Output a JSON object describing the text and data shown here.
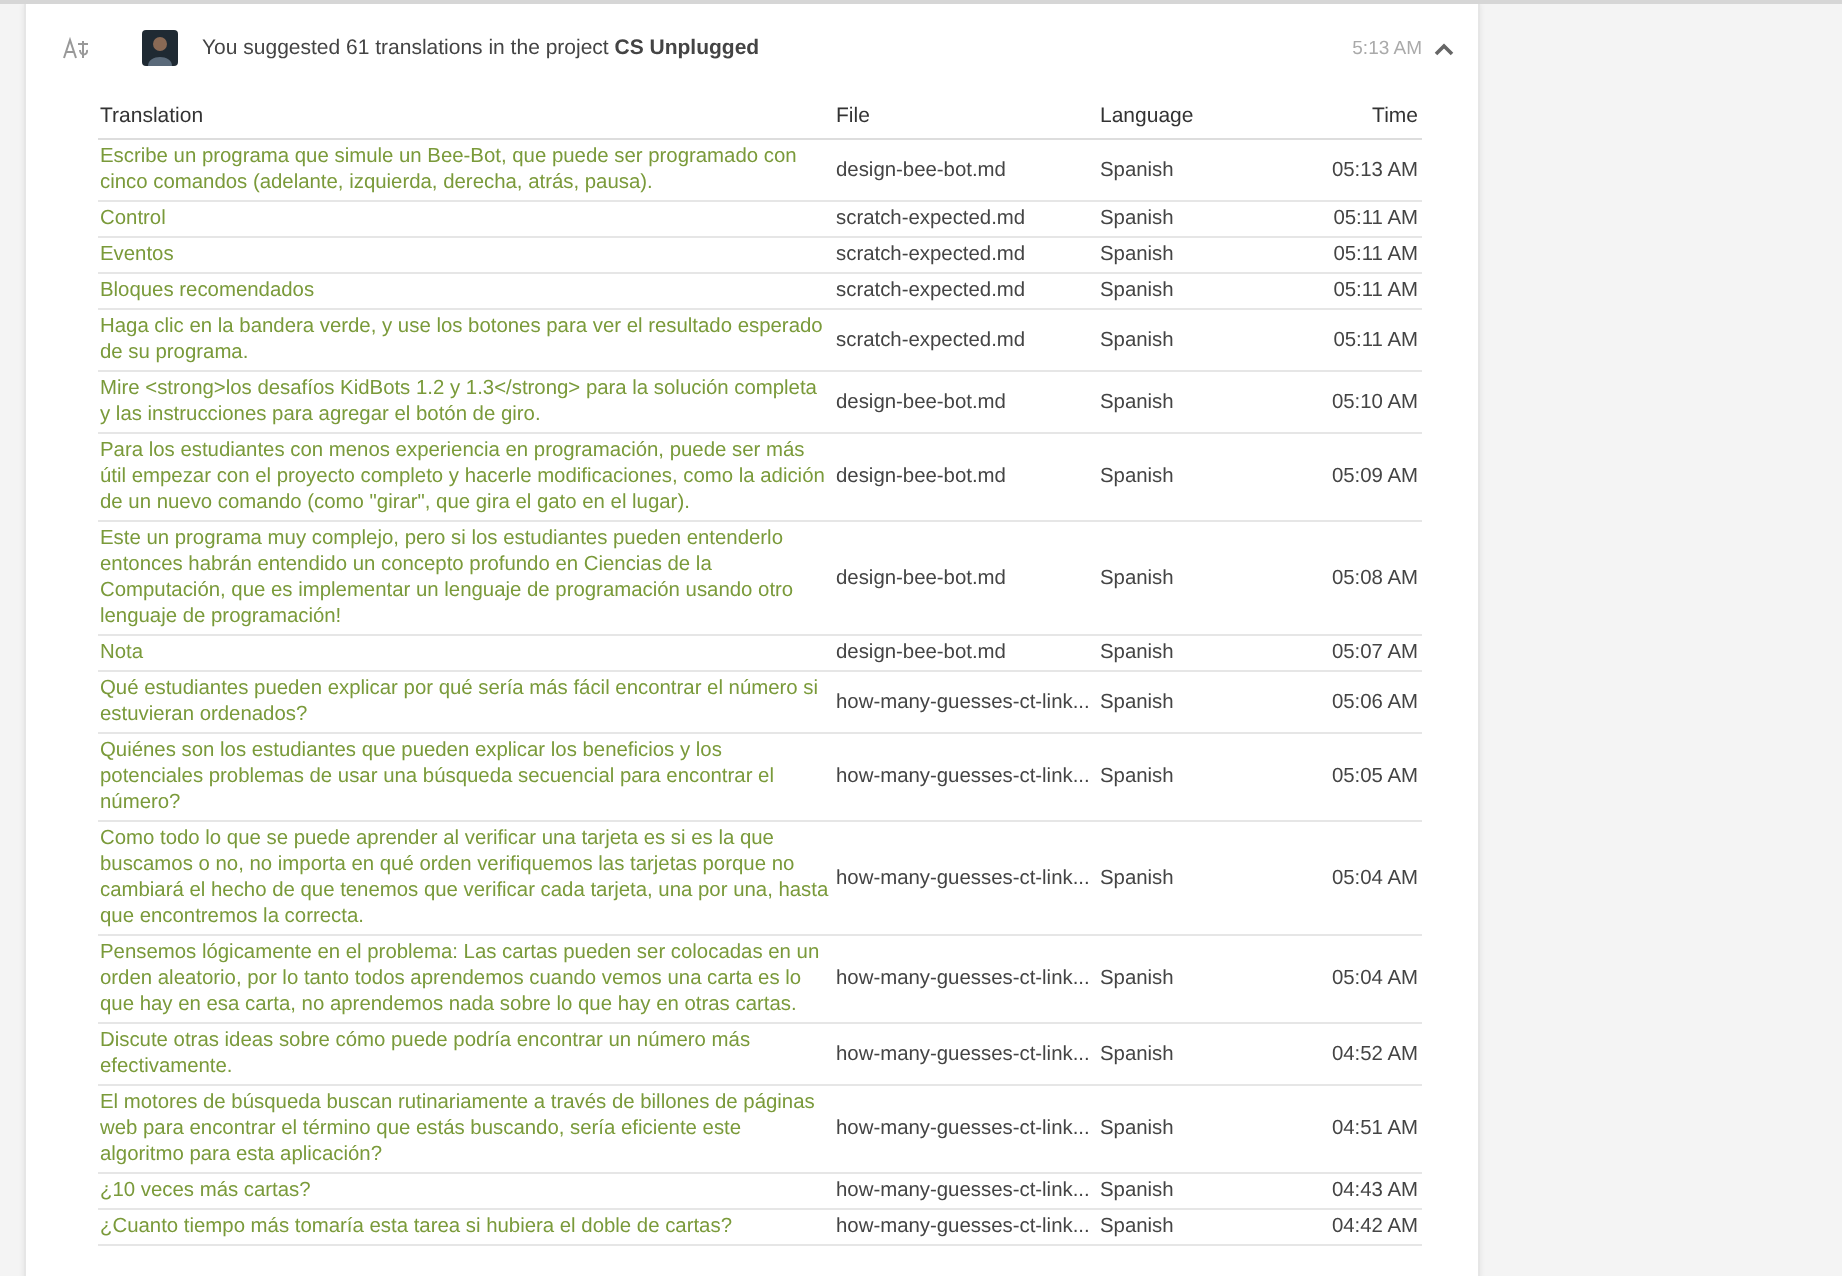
{
  "notification": {
    "message": "You suggested 61 translations in the project **CS Unplugged**",
    "time": "5:13 AM",
    "expanded": true
  },
  "table": {
    "columns": [
      "Translation",
      "File",
      "Language",
      "Time"
    ],
    "rows": [
      {
        "translation": "Escribe un programa que simule un Bee-Bot, que puede ser programado con cinco comandos (adelante, izquierda, derecha, atrás, pausa).",
        "file": "design-bee-bot.md",
        "language": "Spanish",
        "time": "05:13 AM"
      },
      {
        "translation": "Control",
        "file": "scratch-expected.md",
        "language": "Spanish",
        "time": "05:11 AM"
      },
      {
        "translation": "Eventos",
        "file": "scratch-expected.md",
        "language": "Spanish",
        "time": "05:11 AM"
      },
      {
        "translation": "Bloques recomendados",
        "file": "scratch-expected.md",
        "language": "Spanish",
        "time": "05:11 AM"
      },
      {
        "translation": "Haga clic en la bandera verde, y use los botones para ver el resultado esperado de su programa.",
        "file": "scratch-expected.md",
        "language": "Spanish",
        "time": "05:11 AM"
      },
      {
        "translation": "Mire <strong>los desafíos KidBots 1.2 y 1.3</strong> para la solución completa y las instrucciones para agregar el botón de giro.",
        "file": "design-bee-bot.md",
        "language": "Spanish",
        "time": "05:10 AM"
      },
      {
        "translation": "Para los estudiantes con menos experiencia en programación, puede ser más útil empezar con el proyecto completo y hacerle modificaciones, como la adición de un nuevo comando (como \"girar\", que gira el gato en el lugar).",
        "file": "design-bee-bot.md",
        "language": "Spanish",
        "time": "05:09 AM"
      },
      {
        "translation": "Este un programa muy complejo, pero si los estudiantes pueden entenderlo entonces habrán entendido un concepto profundo en Ciencias de la Computación, que es implementar un lenguaje de programación usando otro lenguaje de programación!",
        "file": "design-bee-bot.md",
        "language": "Spanish",
        "time": "05:08 AM"
      },
      {
        "translation": "Nota",
        "file": "design-bee-bot.md",
        "language": "Spanish",
        "time": "05:07 AM"
      },
      {
        "translation": "Qué estudiantes pueden explicar por qué sería más fácil encontrar el número si estuvieran ordenados?",
        "file": "how-many-guesses-ct-link...",
        "language": "Spanish",
        "time": "05:06 AM"
      },
      {
        "translation": "Quiénes son los estudiantes que pueden explicar los beneficios y los potenciales problemas de usar una búsqueda secuencial para encontrar el número?",
        "file": "how-many-guesses-ct-link...",
        "language": "Spanish",
        "time": "05:05 AM"
      },
      {
        "translation": "Como todo lo que se puede aprender al verificar una tarjeta es si es la que buscamos o no, no importa en qué orden verifiquemos las tarjetas porque no cambiará el hecho de que tenemos que verificar cada tarjeta, una por una, hasta que encontremos la correcta.",
        "file": "how-many-guesses-ct-link...",
        "language": "Spanish",
        "time": "05:04 AM"
      },
      {
        "translation": "Pensemos lógicamente en el problema: Las cartas pueden ser colocadas en un orden aleatorio, por lo tanto todos aprendemos cuando vemos una carta es lo que hay en esa carta, no aprendemos nada sobre lo que hay en otras cartas.",
        "file": "how-many-guesses-ct-link...",
        "language": "Spanish",
        "time": "05:04 AM"
      },
      {
        "translation": "Discute otras ideas sobre cómo puede podría encontrar un número más efectivamente.",
        "file": "how-many-guesses-ct-link...",
        "language": "Spanish",
        "time": "04:52 AM"
      },
      {
        "translation": "El motores de búsqueda buscan rutinariamente a través de billones de páginas web para encontrar el término que estás buscando, sería eficiente este algoritmo para esta aplicación?",
        "file": "how-many-guesses-ct-link...",
        "language": "Spanish",
        "time": "04:51 AM"
      },
      {
        "translation": "¿10 veces más cartas?",
        "file": "how-many-guesses-ct-link...",
        "language": "Spanish",
        "time": "04:43 AM"
      },
      {
        "translation": "¿Cuanto tiempo más tomaría esta tarea si hubiera el doble de cartas?",
        "file": "how-many-guesses-ct-link...",
        "language": "Spanish",
        "time": "04:42 AM"
      }
    ]
  }
}
